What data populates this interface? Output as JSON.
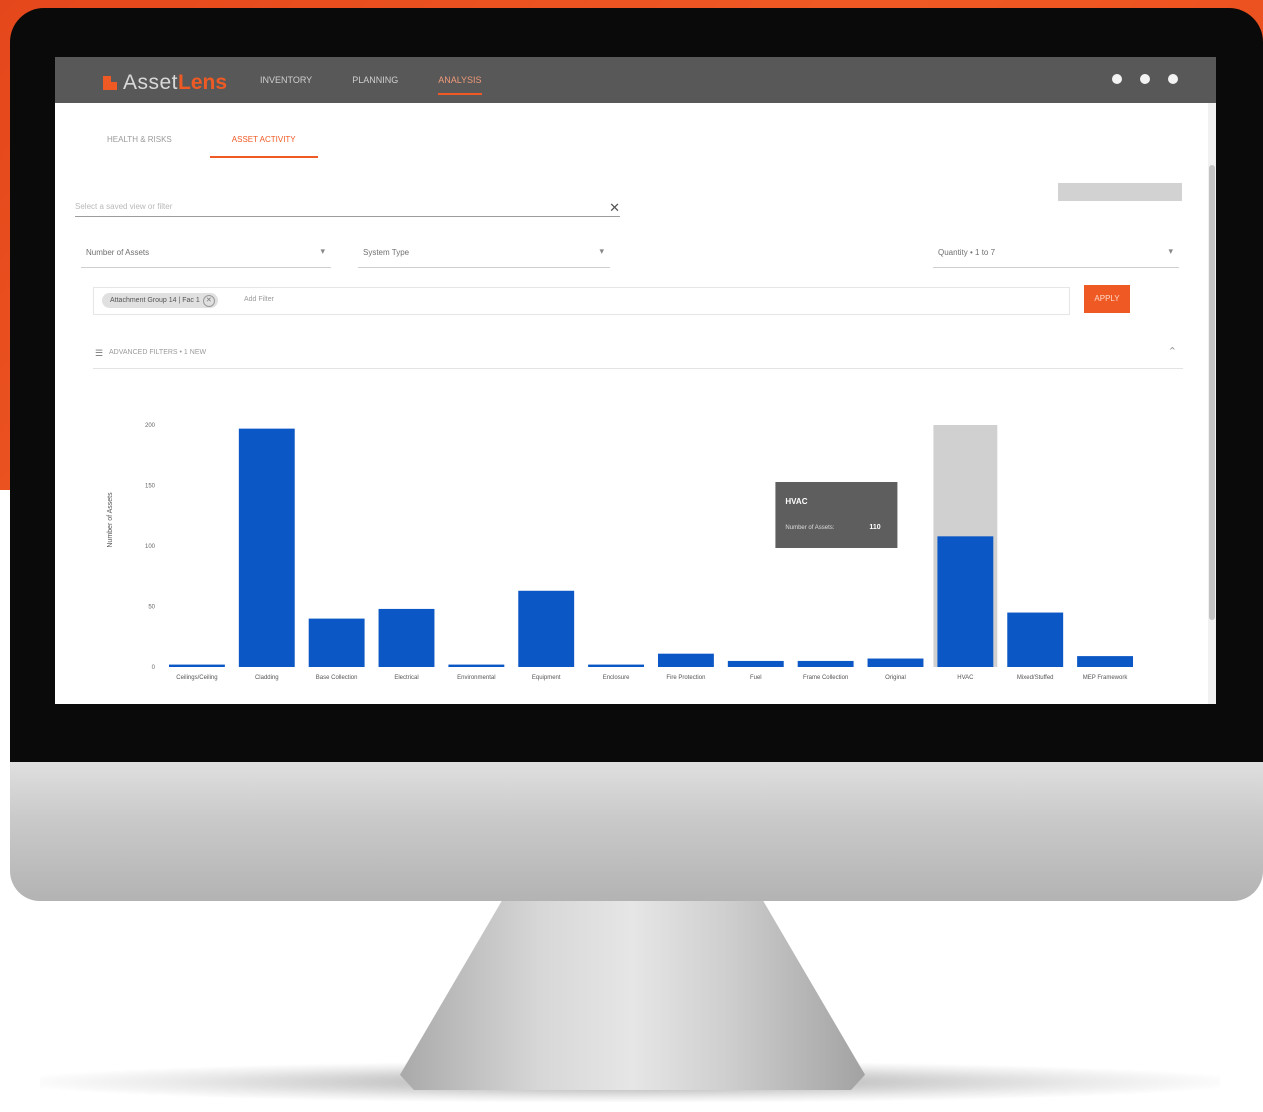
{
  "app": {
    "brand_prefix": "Asset",
    "brand_accent": "Lens",
    "accent_color": "#ef5a24",
    "header_color": "#585858",
    "nav": [
      {
        "label": "INVENTORY",
        "active": false
      },
      {
        "label": "PLANNING",
        "active": false
      },
      {
        "label": "ANALYSIS",
        "active": true
      }
    ],
    "header_icons": [
      "user-icon",
      "help-icon",
      "settings-icon"
    ]
  },
  "tabs": [
    {
      "label": "HEALTH & RISKS",
      "active": false
    },
    {
      "label": "ASSET ACTIVITY",
      "active": true
    }
  ],
  "filters": {
    "search_placeholder": "Select a saved view or filter",
    "group_by": "Number of Assets",
    "asset_type": "System Type",
    "range": "Quantity • 1 to 7",
    "chip_label": "Attachment Group 14 | Fac 1",
    "add_filter": "Add Filter",
    "apply_label": "APPLY",
    "advanced_label": "ADVANCED FILTERS • 1 NEW"
  },
  "tooltip": {
    "title": "HVAC",
    "label": "Number of Assets:",
    "value": "110"
  },
  "chart_data": {
    "type": "bar",
    "ylabel": "Number of Assets",
    "ylim": [
      0,
      200
    ],
    "yticks": [
      0,
      50,
      100,
      150,
      200
    ],
    "bar_color": "#0b57c5",
    "highlight_color": "#d0d0d0",
    "highlight_category": "HVAC",
    "categories": [
      "Ceilings/Ceiling",
      "Cladding",
      "Base Collection",
      "Electrical",
      "Environmental",
      "Equipment",
      "Enclosure",
      "Fire Protection",
      "Fuel",
      "Frame Collection",
      "Original",
      "HVAC",
      "Mixed/Stuffed",
      "MEP Framework"
    ],
    "values": [
      2,
      197,
      40,
      48,
      2,
      63,
      2,
      11,
      5,
      5,
      7,
      108,
      45,
      9
    ]
  }
}
